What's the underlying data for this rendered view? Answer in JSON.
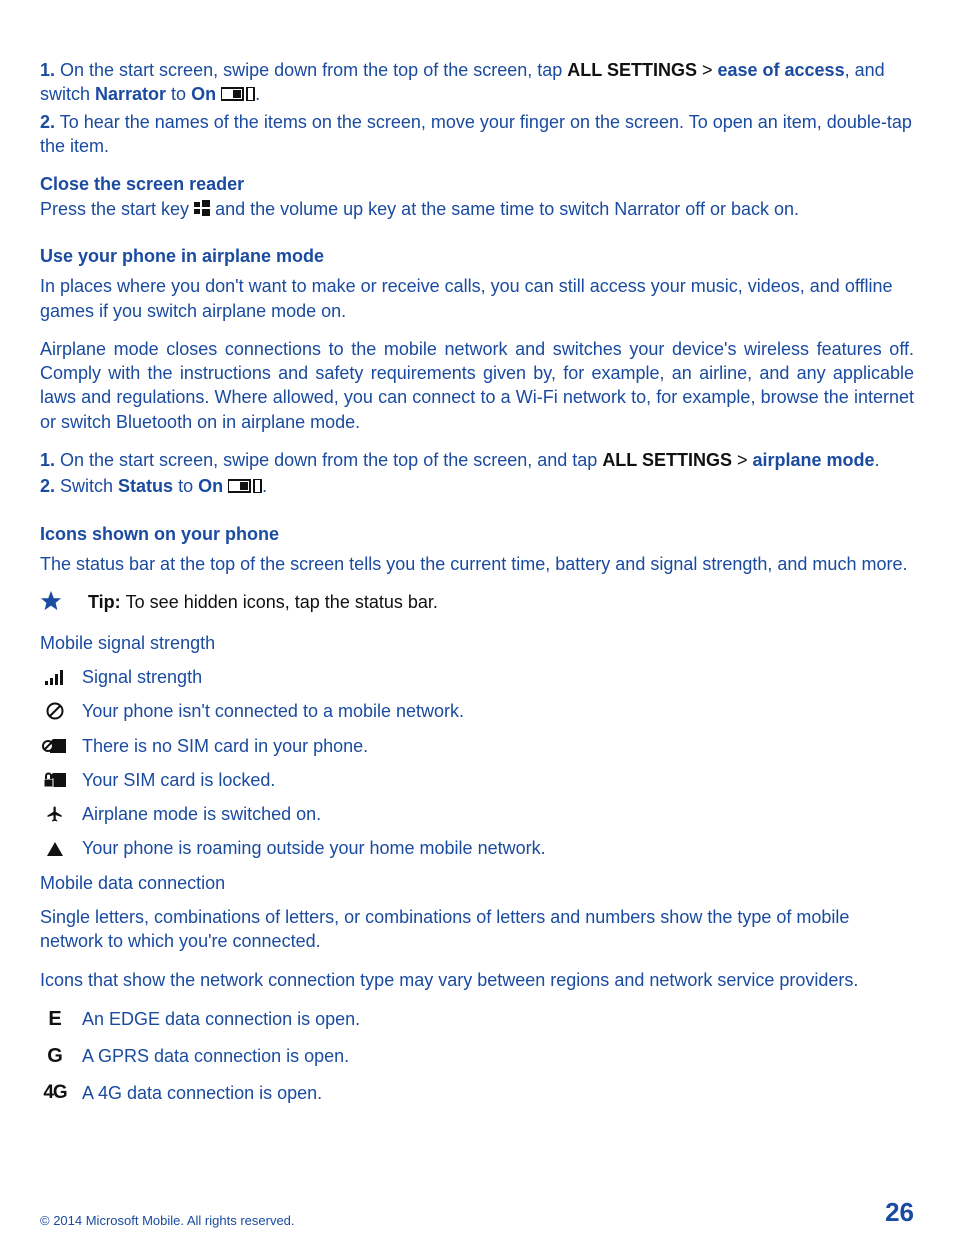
{
  "step1_prefix": "1.",
  "step1_text_a": " On the start screen, swipe down from the top of the screen, tap ",
  "step1_all_settings": "ALL SETTINGS",
  "gt": " > ",
  "step1_ease": "ease of access",
  "step1_text_b": ", and switch ",
  "step1_narrator": "Narrator",
  "step1_to": " to ",
  "step1_on": "On",
  "period": ".",
  "step2_prefix": "2.",
  "step2_text": " To hear the names of the items on the screen, move your finger on the screen. To open an item, double-tap the item.",
  "close_reader_title": "Close the screen reader",
  "close_reader_a": "Press the start key ",
  "close_reader_b": " and the volume up key at the same time to switch Narrator off or back on.",
  "airplane_title": "Use your phone in airplane mode",
  "airplane_p1": "In places where you don't want to make or receive calls, you can still access your music, videos, and offline games if you switch airplane mode on.",
  "airplane_p2": "Airplane mode closes connections to the mobile network and switches your device's wireless features off. Comply with the instructions and safety requirements given by, for example, an airline, and any applicable laws and regulations. Where allowed, you can connect to a Wi-Fi network to, for example, browse the internet or switch Bluetooth on in airplane mode.",
  "ap_step1_a": " On the start screen, swipe down from the top of the screen, and tap ",
  "ap_step1_mode": "airplane mode",
  "ap_step2_a": " Switch ",
  "ap_step2_status": "Status",
  "icons_title": "Icons shown on your phone",
  "icons_p1": "The status bar at the top of the screen tells you the current time, battery and signal strength, and much more.",
  "tip_label": "Tip: ",
  "tip_text": "To see hidden icons, tap the status bar.",
  "mobile_signal_heading": "Mobile signal strength",
  "row_signal": "Signal strength",
  "row_no_network": "Your phone isn't connected to a mobile network.",
  "row_no_sim": "There is no SIM card in your phone.",
  "row_sim_locked": "Your SIM card is locked.",
  "row_airplane": "Airplane mode is switched on.",
  "row_roaming": "Your phone is roaming outside your home mobile network.",
  "mobile_data_heading": "Mobile data connection",
  "data_p1": "Single letters, combinations of letters, or combinations of letters and numbers show the type of mobile network to which you're connected.",
  "data_p2": "Icons that show the network connection type may vary between regions and network service providers.",
  "row_edge_icon": "E",
  "row_edge": "An EDGE data connection is open.",
  "row_gprs_icon": "G",
  "row_gprs": "A GPRS data connection is open.",
  "row_4g_icon": "4G",
  "row_4g": "A 4G data connection is open.",
  "copyright": "© 2014 Microsoft Mobile. All rights reserved.",
  "page_num": "26"
}
